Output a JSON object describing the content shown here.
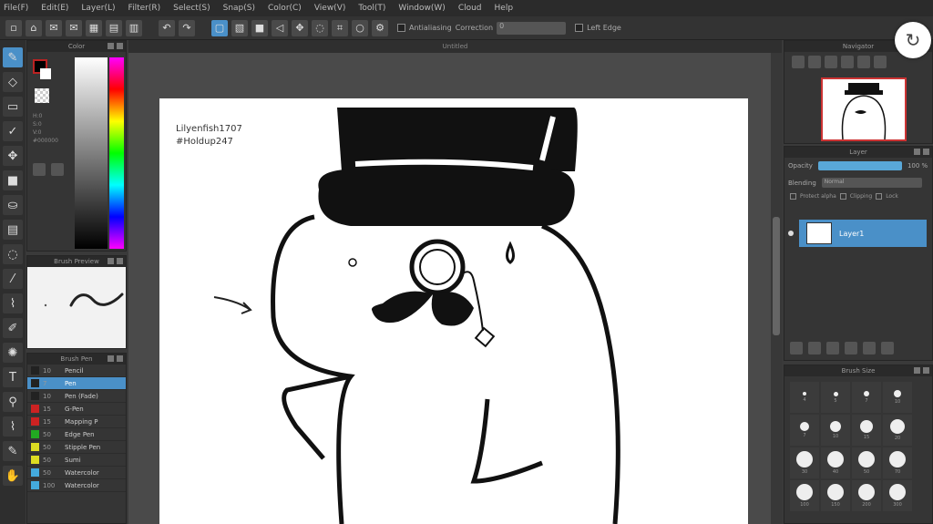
{
  "menu": {
    "items": [
      "File(F)",
      "Edit(E)",
      "Layer(L)",
      "Filter(R)",
      "Select(S)",
      "Snap(S)",
      "Color(C)",
      "View(V)",
      "Tool(T)",
      "Window(W)",
      "Cloud",
      "Help"
    ]
  },
  "toolbar": {
    "antialiasing_label": "Antialiasing",
    "correction_label": "Correction",
    "correction_value": "0",
    "leftedge_label": "Left Edge"
  },
  "panels": {
    "color_title": "Color",
    "brush_preview_title": "Brush Preview",
    "brush_title": "Brush Pen",
    "navigator_title": "Navigator",
    "layer_title": "Layer",
    "brush_size_title": "Brush Size"
  },
  "color": {
    "hsv_text": "H:0\nS:0\nV:0\n#000000",
    "foreground": "#000000",
    "background": "#ffffff"
  },
  "brushes": [
    {
      "size": "10",
      "name": "Pencil",
      "color": "#222222",
      "active": false
    },
    {
      "size": "7",
      "name": "Pen",
      "color": "#222222",
      "active": true
    },
    {
      "size": "10",
      "name": "Pen (Fade)",
      "color": "#222222",
      "active": false
    },
    {
      "size": "15",
      "name": "G-Pen",
      "color": "#cc2222",
      "active": false
    },
    {
      "size": "15",
      "name": "Mapping P",
      "color": "#cc2222",
      "active": false
    },
    {
      "size": "50",
      "name": "Edge Pen",
      "color": "#22aa22",
      "active": false
    },
    {
      "size": "50",
      "name": "Stipple Pen",
      "color": "#dddd22",
      "active": false
    },
    {
      "size": "50",
      "name": "Sumi",
      "color": "#dddd22",
      "active": false
    },
    {
      "size": "50",
      "name": "Watercolor",
      "color": "#44aadd",
      "active": false
    },
    {
      "size": "100",
      "name": "Watercolor",
      "color": "#44aadd",
      "active": false
    }
  ],
  "canvas": {
    "tab_label": "Untitled",
    "hashtag_user": "Lilyenfish1707",
    "hashtag_tag": "#Holdup247"
  },
  "layer": {
    "opacity_label": "Opacity",
    "opacity_value": "100 %",
    "blending_label": "Blending",
    "blending_value": "Normal",
    "protect_alpha": "Protect alpha",
    "clipping": "Clipping",
    "lock": "Lock",
    "layer_name": "Layer1"
  },
  "brush_sizes": [
    {
      "label": "4",
      "d": 4
    },
    {
      "label": "5",
      "d": 5
    },
    {
      "label": "7",
      "d": 6
    },
    {
      "label": "10",
      "d": 8
    },
    {
      "label": "7",
      "d": 10
    },
    {
      "label": "10",
      "d": 12
    },
    {
      "label": "15",
      "d": 14
    },
    {
      "label": "20",
      "d": 16
    },
    {
      "label": "30",
      "d": 18
    },
    {
      "label": "40",
      "d": 18
    },
    {
      "label": "50",
      "d": 18
    },
    {
      "label": "70",
      "d": 18
    },
    {
      "label": "100",
      "d": 18
    },
    {
      "label": "150",
      "d": 18
    },
    {
      "label": "200",
      "d": 18
    },
    {
      "label": "300",
      "d": 18
    }
  ]
}
